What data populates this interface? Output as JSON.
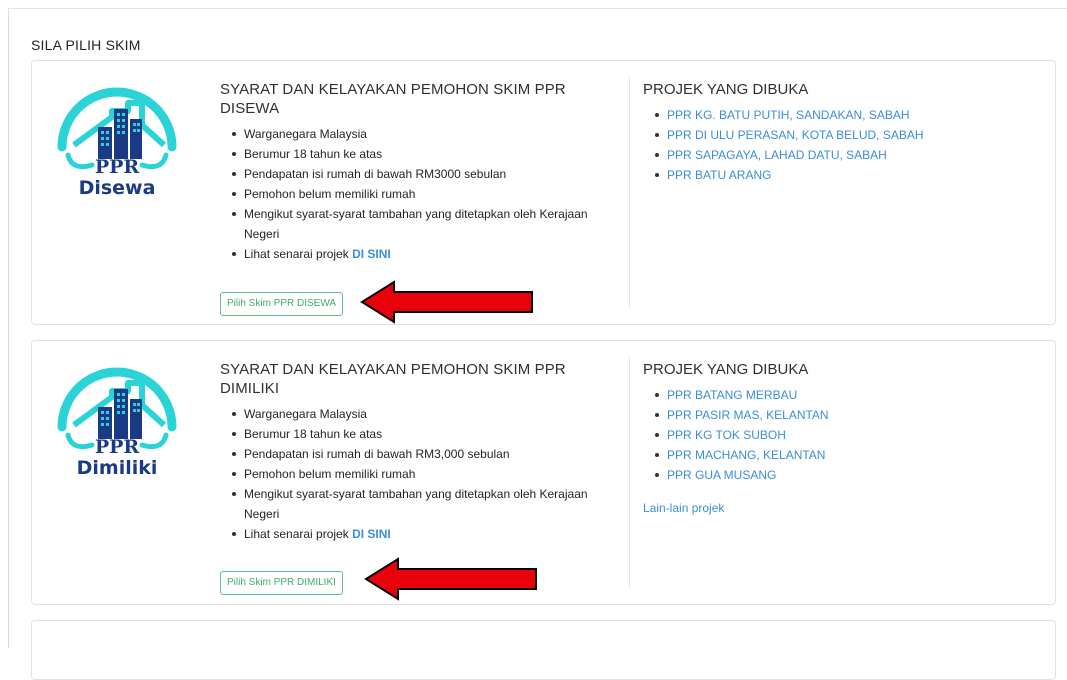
{
  "section_title": "SILA PILIH SKIM",
  "schemes": [
    {
      "logo_line1": "PPR",
      "logo_line2": "Disewa",
      "title": "SYARAT DAN KELAYAKAN PEMOHON SKIM PPR DISEWA",
      "requirements": [
        "Warganegara Malaysia",
        "Berumur 18 tahun ke atas",
        "Pendapatan isi rumah di bawah RM3000 sebulan",
        "Pemohon belum memiliki rumah",
        "Mengikut syarat-syarat tambahan yang ditetapkan oleh Kerajaan Negeri"
      ],
      "list_link_prefix": "Lihat senarai projek ",
      "list_link_label": "DI SINI",
      "select_button": "Pilih Skim PPR DISEWA",
      "projects_title": "PROJEK YANG DIBUKA",
      "projects": [
        "PPR KG. BATU PUTIH, SANDAKAN, SABAH",
        "PPR DI ULU PERASAN, KOTA BELUD, SABAH",
        "PPR SAPAGAYA, LAHAD DATU, SABAH",
        "PPR BATU ARANG"
      ],
      "other_link": ""
    },
    {
      "logo_line1": "PPR",
      "logo_line2": "Dimiliki",
      "title": "SYARAT DAN KELAYAKAN PEMOHON SKIM PPR DIMILIKI",
      "requirements": [
        "Warganegara Malaysia",
        "Berumur 18 tahun ke atas",
        "Pendapatan isi rumah di bawah RM3,000 sebulan",
        "Pemohon belum memiliki rumah",
        "Mengikut syarat-syarat tambahan yang ditetapkan oleh Kerajaan Negeri"
      ],
      "list_link_prefix": "Lihat senarai projek ",
      "list_link_label": "DI SINI",
      "select_button": "Pilih Skim PPR DIMILIKI",
      "projects_title": "PROJEK YANG DIBUKA",
      "projects": [
        "PPR BATANG MERBAU",
        "PPR PASIR MAS, KELANTAN",
        "PPR KG TOK SUBOH",
        "PPR MACHANG, KELANTAN",
        "PPR GUA MUSANG"
      ],
      "other_link": "Lain-lain projek"
    }
  ],
  "colors": {
    "logo_cyan": "#2ad3d6",
    "logo_navy": "#1b3a86",
    "button_green": "#3fae6a",
    "link_blue": "#3a8ed8",
    "arrow_red": "#e8000b"
  },
  "icons": {
    "logo": "building-roof-logo",
    "annotation": "red-arrow-pointing-left"
  }
}
